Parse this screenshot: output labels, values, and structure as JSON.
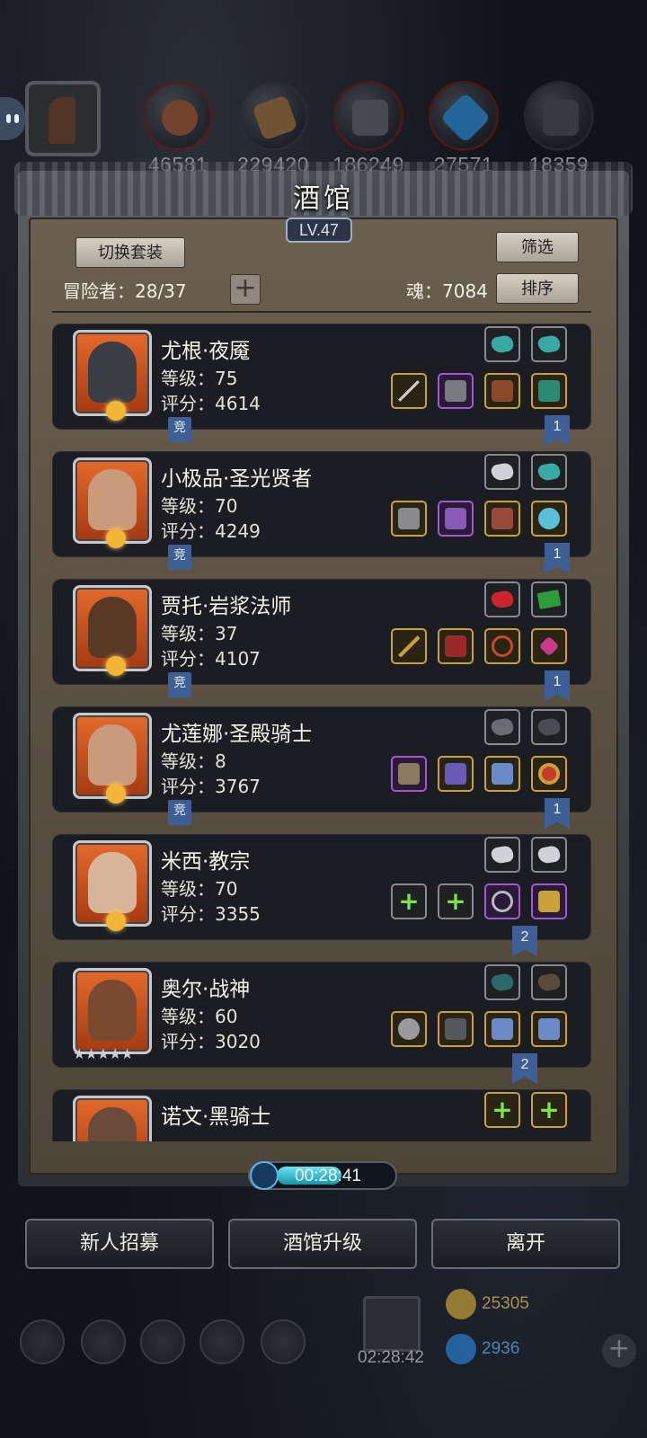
{
  "resources": [
    {
      "name": "resource-ore",
      "value": "46581"
    },
    {
      "name": "resource-wood",
      "value": "229420"
    },
    {
      "name": "resource-stone",
      "value": "186249"
    },
    {
      "name": "resource-crystal",
      "value": "27571"
    },
    {
      "name": "resource-iron",
      "value": "18359"
    }
  ],
  "tavern": {
    "title": "酒馆",
    "level": "LV.47",
    "switch_outfit": "切换套装",
    "filter": "筛选",
    "sort": "排序",
    "adventurers_label": "冒险者：28/37",
    "soul_label": "魂：7084"
  },
  "heroes": [
    {
      "name": "尤根·夜魇",
      "level": "等级：75",
      "score": "评分：4614",
      "badge_left": "竞",
      "badge_right": "1",
      "portrait": "#e0692a",
      "face": "#3a3d44",
      "stars": ""
    },
    {
      "name": "小极品·圣光贤者",
      "level": "等级：70",
      "score": "评分：4249",
      "badge_left": "竞",
      "badge_right": "1",
      "portrait": "#e0692a",
      "face": "#c99a7c",
      "stars": ""
    },
    {
      "name": "贾托·岩浆法师",
      "level": "等级：37",
      "score": "评分：4107",
      "badge_left": "竞",
      "badge_right": "1",
      "portrait": "#e0692a",
      "face": "#5a3826",
      "stars": ""
    },
    {
      "name": "尤莲娜·圣殿骑士",
      "level": "等级：8",
      "score": "评分：3767",
      "badge_left": "竞",
      "badge_right": "1",
      "portrait": "#e0692a",
      "face": "#c99a7c",
      "stars": ""
    },
    {
      "name": "米西·教宗",
      "level": "等级：70",
      "score": "评分：3355",
      "badge_left": "",
      "badge_right": "2",
      "portrait": "#e0692a",
      "face": "#d8b49a",
      "stars": ""
    },
    {
      "name": "奥尔·战神",
      "level": "等级：60",
      "score": "评分：3020",
      "badge_left": "",
      "badge_right": "2",
      "portrait": "#e0692a",
      "face": "#7a4a30",
      "stars": "★★★★★"
    },
    {
      "name": "诺文·黑骑士",
      "level": "",
      "score": "",
      "badge_left": "",
      "badge_right": "",
      "portrait": "#e0692a",
      "face": "#6a4a38",
      "stars": ""
    }
  ],
  "timer": {
    "time": "00:28:41",
    "progress": 0.55
  },
  "actions": {
    "recruit": "新人招募",
    "upgrade": "酒馆升级",
    "leave": "离开"
  },
  "dock": {
    "gift_timer": "02:28:42",
    "gold": "25305",
    "gems": "2936"
  }
}
